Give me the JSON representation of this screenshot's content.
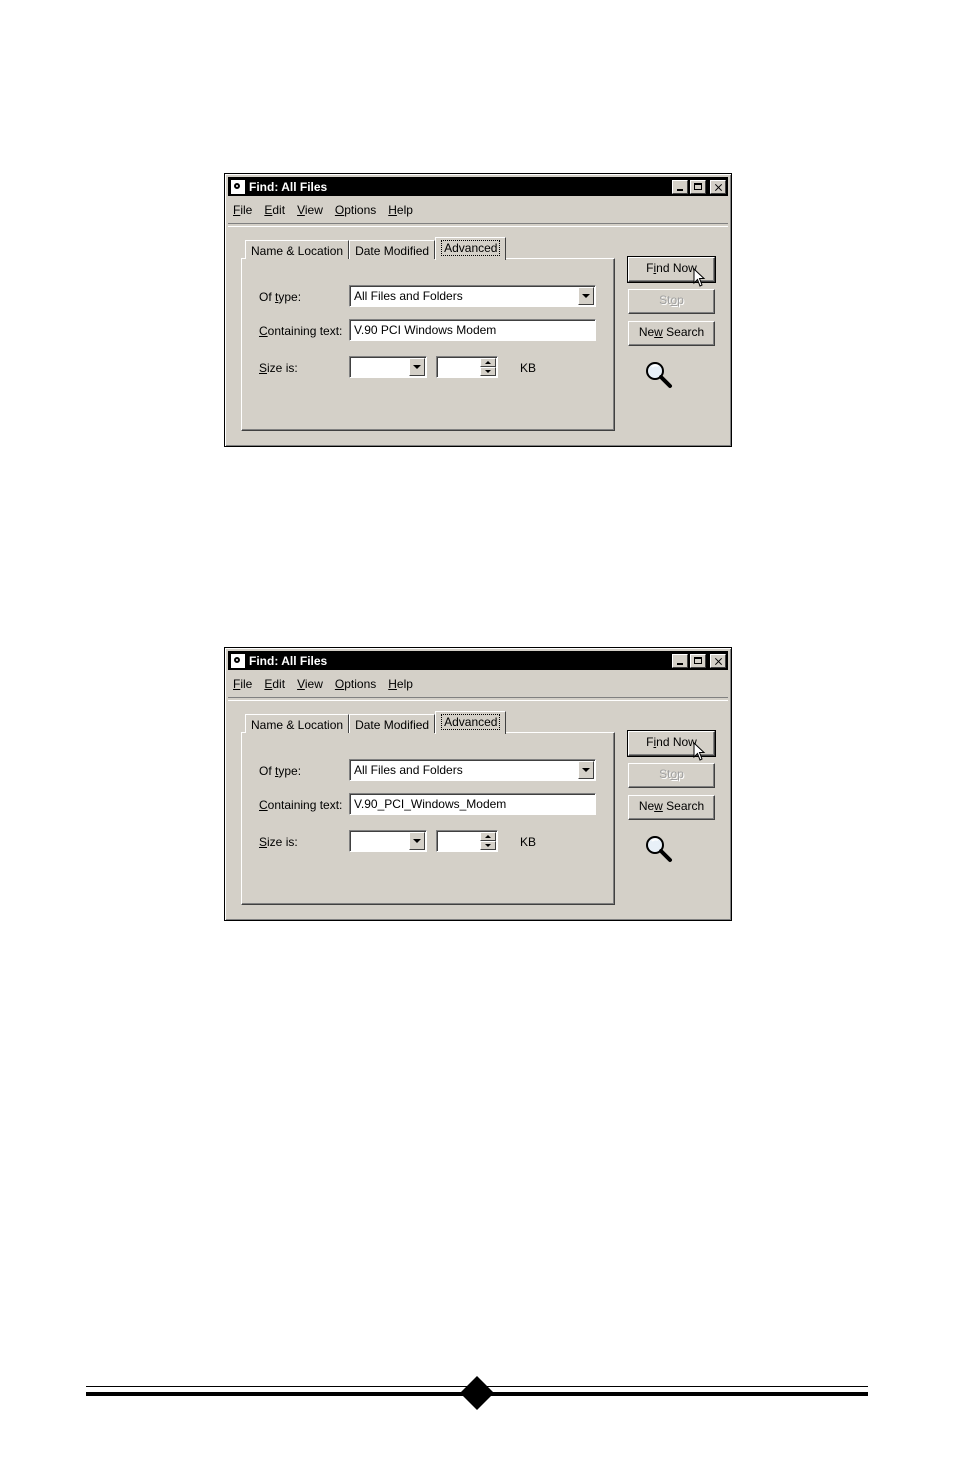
{
  "dialogs": [
    {
      "title": "Find: All Files",
      "menu": [
        {
          "u": "F",
          "rest": "ile"
        },
        {
          "u": "E",
          "rest": "dit"
        },
        {
          "u": "V",
          "rest": "iew"
        },
        {
          "u": "O",
          "rest": "ptions"
        },
        {
          "u": "H",
          "rest": "elp"
        }
      ],
      "tabs": {
        "name_location": "Name & Location",
        "date_modified": "Date Modified",
        "advanced": "Advanced"
      },
      "labels": {
        "type_pre": "Of ",
        "type_u": "t",
        "type_post": "ype:",
        "text_u": "C",
        "text_post": "ontaining text:",
        "size_u": "S",
        "size_post": "ize is:",
        "kb": "KB"
      },
      "type_value": "All Files and Folders",
      "containing_text": "V.90 PCI Windows Modem",
      "size_value": "",
      "size_number": "",
      "buttons": {
        "find_pre": "F",
        "find_u": "i",
        "find_post": "nd Now",
        "stop_pre": "St",
        "stop_u": "o",
        "stop_post": "p",
        "new_pre": "Ne",
        "new_u": "w",
        "new_post": " Search"
      }
    },
    {
      "title": "Find: All Files",
      "menu": [
        {
          "u": "F",
          "rest": "ile"
        },
        {
          "u": "E",
          "rest": "dit"
        },
        {
          "u": "V",
          "rest": "iew"
        },
        {
          "u": "O",
          "rest": "ptions"
        },
        {
          "u": "H",
          "rest": "elp"
        }
      ],
      "tabs": {
        "name_location": "Name & Location",
        "date_modified": "Date Modified",
        "advanced": "Advanced"
      },
      "labels": {
        "type_pre": "Of ",
        "type_u": "t",
        "type_post": "ype:",
        "text_u": "C",
        "text_post": "ontaining text:",
        "size_u": "S",
        "size_post": "ize is:",
        "kb": "KB"
      },
      "type_value": "All Files and Folders",
      "containing_text": "V.90_PCI_Windows_Modem",
      "size_value": "",
      "size_number": "",
      "buttons": {
        "find_pre": "F",
        "find_u": "i",
        "find_post": "nd Now",
        "stop_pre": "St",
        "stop_u": "o",
        "stop_post": "p",
        "new_pre": "Ne",
        "new_u": "w",
        "new_post": " Search"
      }
    }
  ],
  "colors": {
    "face": "#d4d0c8",
    "title_bar": "#000000",
    "page": "#ffffff"
  }
}
